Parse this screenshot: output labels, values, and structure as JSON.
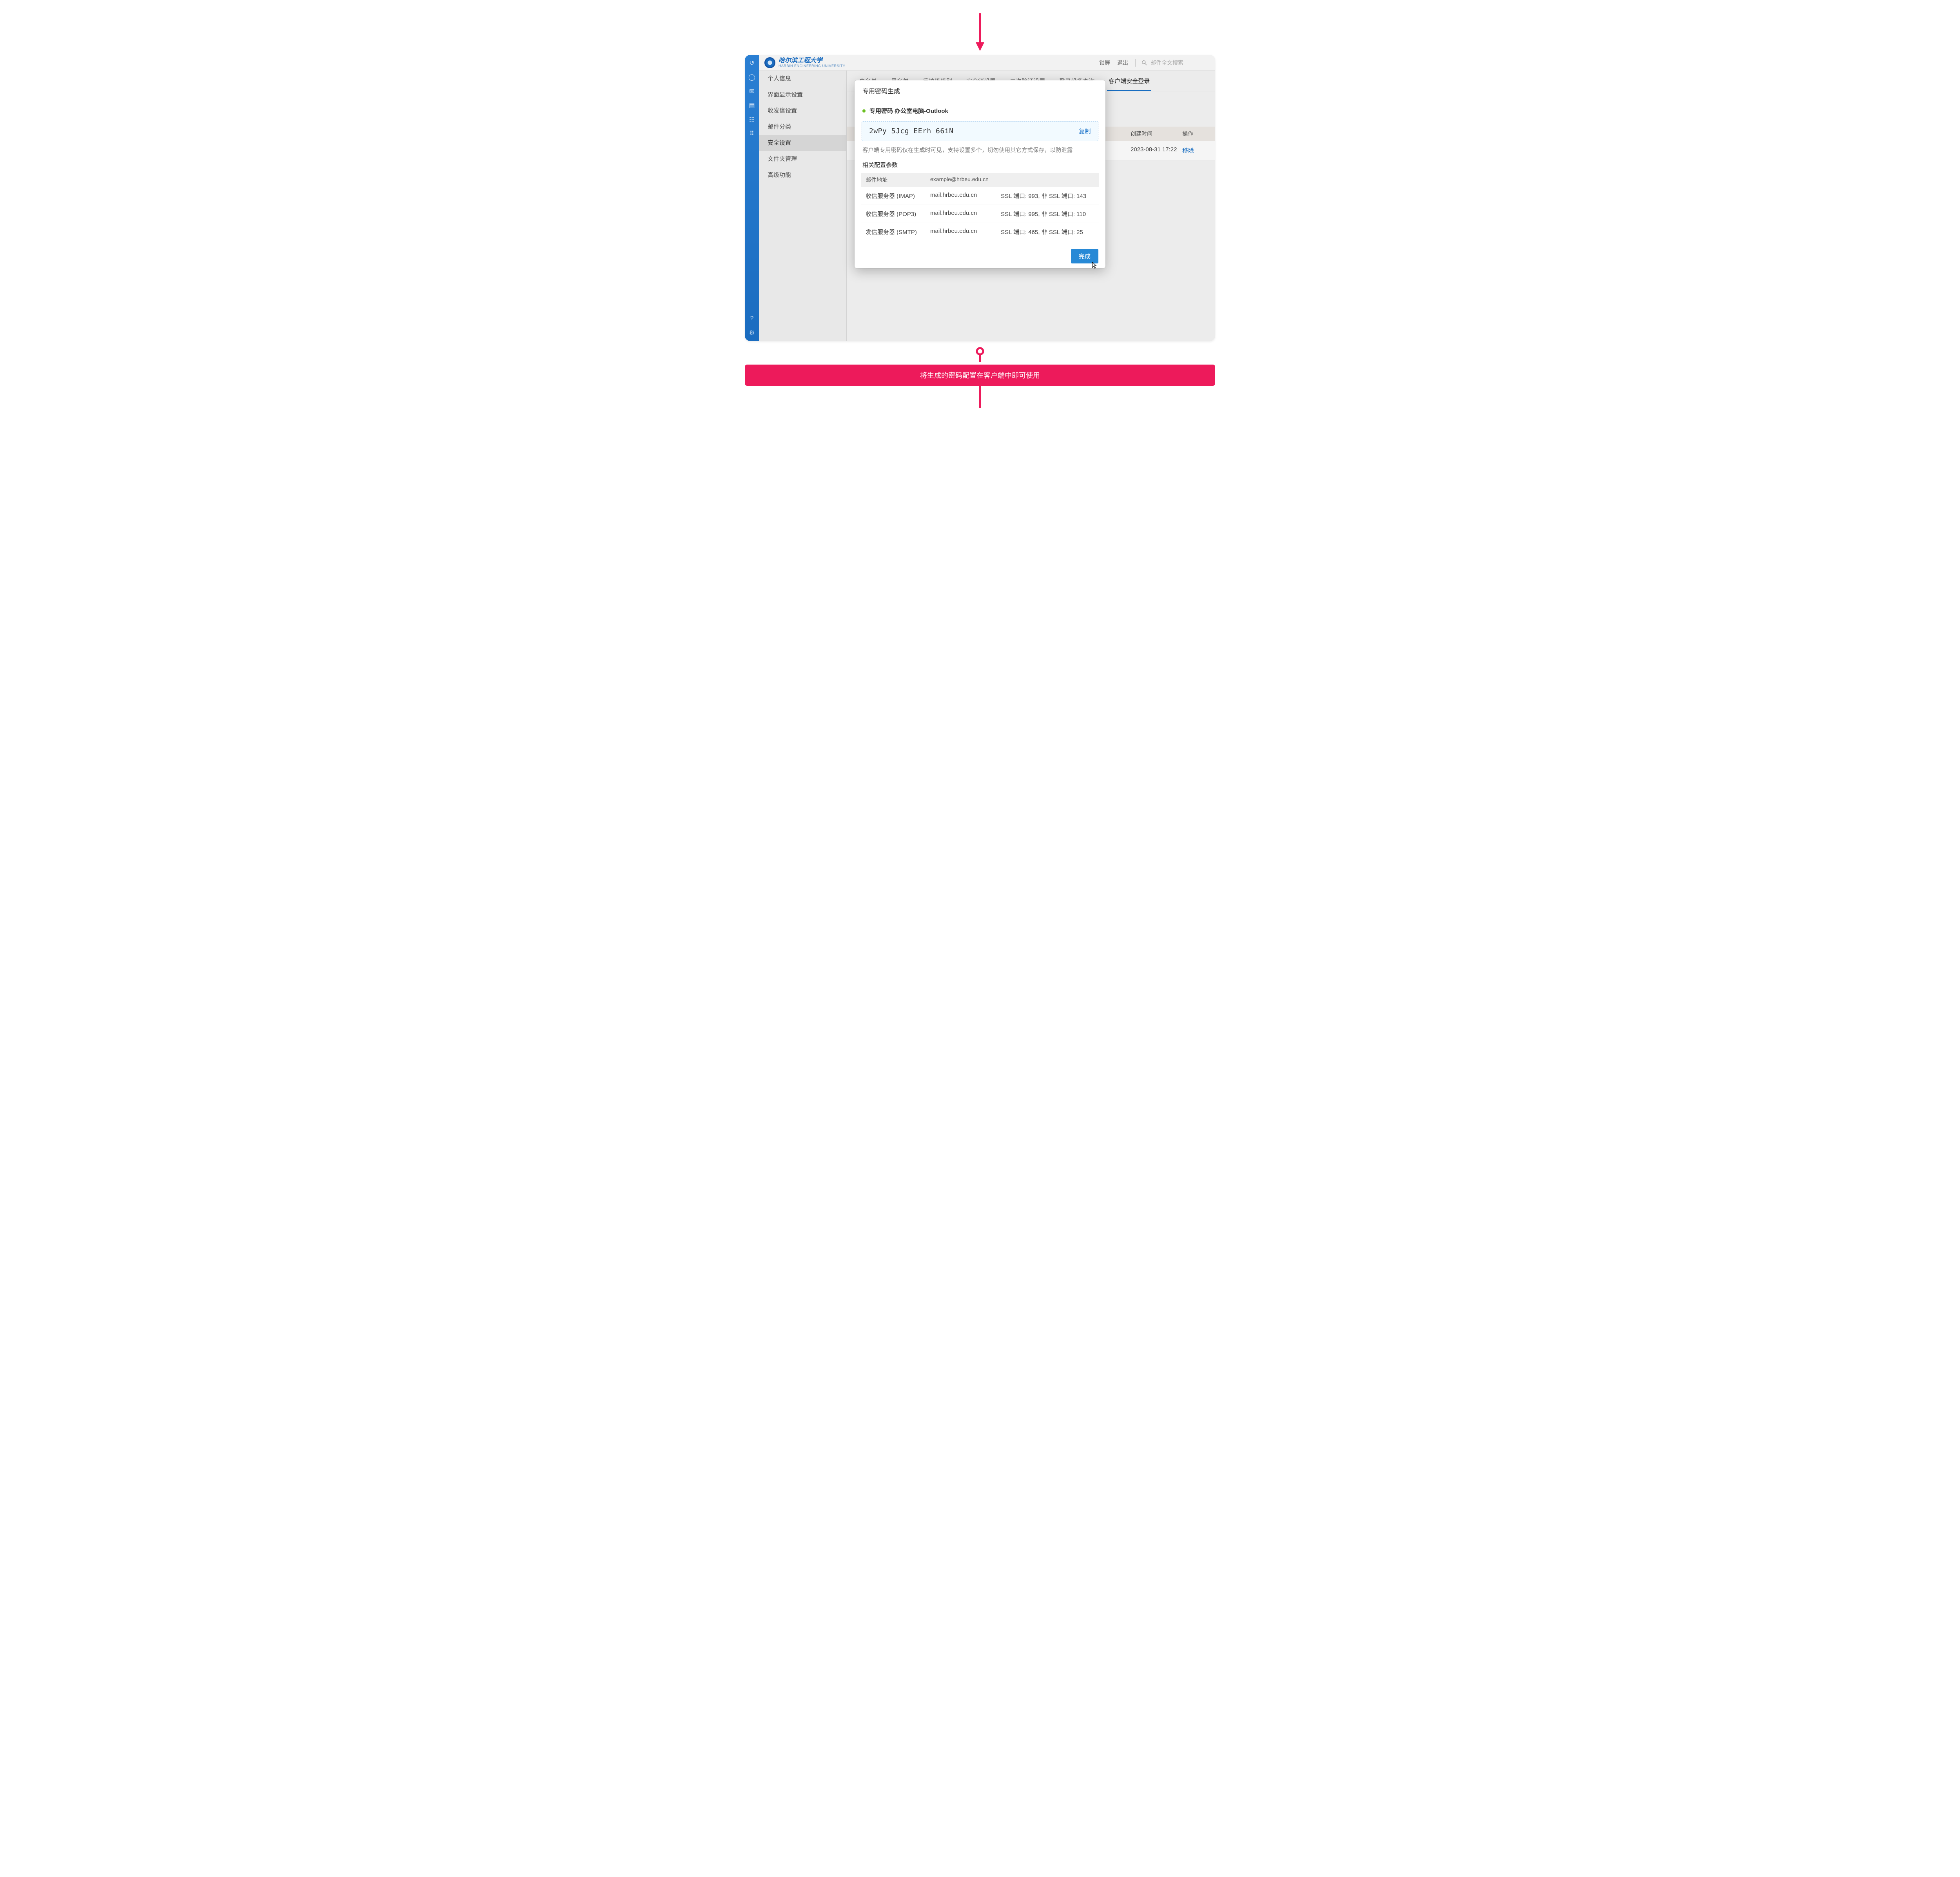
{
  "topbar": {
    "brand_cn": "哈尔滨工程大学",
    "brand_en": "HARBIN ENGINEERING UNIVERSITY",
    "lock": "锁屏",
    "logout": "退出",
    "search_placeholder": "邮件全文搜索"
  },
  "sidebar": {
    "items": [
      "个人信息",
      "界面显示设置",
      "收发信设置",
      "邮件分类",
      "安全设置",
      "文件夹管理",
      "高级功能"
    ],
    "active_index": 4
  },
  "tabs": {
    "items": [
      "白名单",
      "黑名单",
      "反垃圾级别",
      "安全锁设置",
      "二次验证设置",
      "登录设备查询",
      "客户端安全登录"
    ],
    "active_index": 6
  },
  "table": {
    "cols": {
      "created": "创建时间",
      "action": "操作"
    },
    "row": {
      "created": "2023-08-31 17:22",
      "action": "移除"
    }
  },
  "dialog": {
    "title": "专用密码生成",
    "sub": "专用密码 办公室电脑-Outlook",
    "password": "2wPy  5Jcg  EErh  66iN",
    "copy": "复制",
    "note": "客户端专用密码仅在生成时可见，支持设置多个，切勿使用其它方式保存，以防泄露",
    "params_title": "相关配置参数",
    "cfg_head": {
      "label": "邮件地址",
      "value": "example@hrbeu.edu.cn"
    },
    "cfg_rows": [
      {
        "label": "收信服务器 (IMAP)",
        "host": "mail.hrbeu.edu.cn",
        "ports": "SSL 端口: 993, 非 SSL 端口: 143"
      },
      {
        "label": "收信服务器 (POP3)",
        "host": "mail.hrbeu.edu.cn",
        "ports": "SSL 端口: 995, 非 SSL 端口: 110"
      },
      {
        "label": "发信服务器 (SMTP)",
        "host": "mail.hrbeu.edu.cn",
        "ports": "SSL 端口: 465, 非 SSL 端口: 25"
      }
    ],
    "done": "完成"
  },
  "callout": "将生成的密码配置在客户端中即可使用"
}
